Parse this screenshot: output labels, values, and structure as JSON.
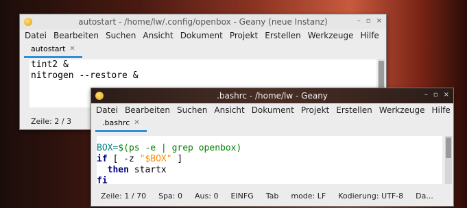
{
  "window1": {
    "title": "autostart - /home/lw/.config/openbox - Geany (neue Instanz)",
    "controls": {
      "minimize": "–",
      "maximize": "▫",
      "close": "×"
    },
    "menu": [
      "Datei",
      "Bearbeiten",
      "Suchen",
      "Ansicht",
      "Dokument",
      "Projekt",
      "Erstellen",
      "Werkzeuge",
      "Hilfe"
    ],
    "tab": {
      "label": "autostart",
      "close": "✕"
    },
    "lines": [
      "tint2 &",
      "nitrogen --restore &"
    ],
    "status": {
      "line": "Zeile: 2 / 3"
    }
  },
  "window2": {
    "title": ".bashrc - /home/lw - Geany",
    "controls": {
      "minimize": "–",
      "maximize": "▫",
      "close": "×"
    },
    "menu": [
      "Datei",
      "Bearbeiten",
      "Suchen",
      "Ansicht",
      "Dokument",
      "Projekt",
      "Erstellen",
      "Werkzeuge",
      "Hilfe"
    ],
    "tab": {
      "label": ".bashrc",
      "close": "✕"
    },
    "code": {
      "l1_var": "BOX=",
      "l1_sub": "$(ps -e | grep openbox)",
      "l2_kw": "if",
      "l2_mid": " [ -z ",
      "l2_str": "\"$BOX\"",
      "l2_end": " ]",
      "l3_kw": "then",
      "l3_rest": " startx",
      "l4_kw": "fi"
    },
    "status": {
      "line": "Zeile: 1 / 70",
      "col": "Spa: 0",
      "sel": "Aus: 0",
      "mode_ins": "EINFG",
      "tab": "Tab",
      "eol": "mode: LF",
      "encoding": "Kodierung: UTF-8",
      "more": "Da..."
    }
  },
  "colors": {
    "accent": "#2d8fd6",
    "titlebar_dark": "#3a2a24"
  }
}
